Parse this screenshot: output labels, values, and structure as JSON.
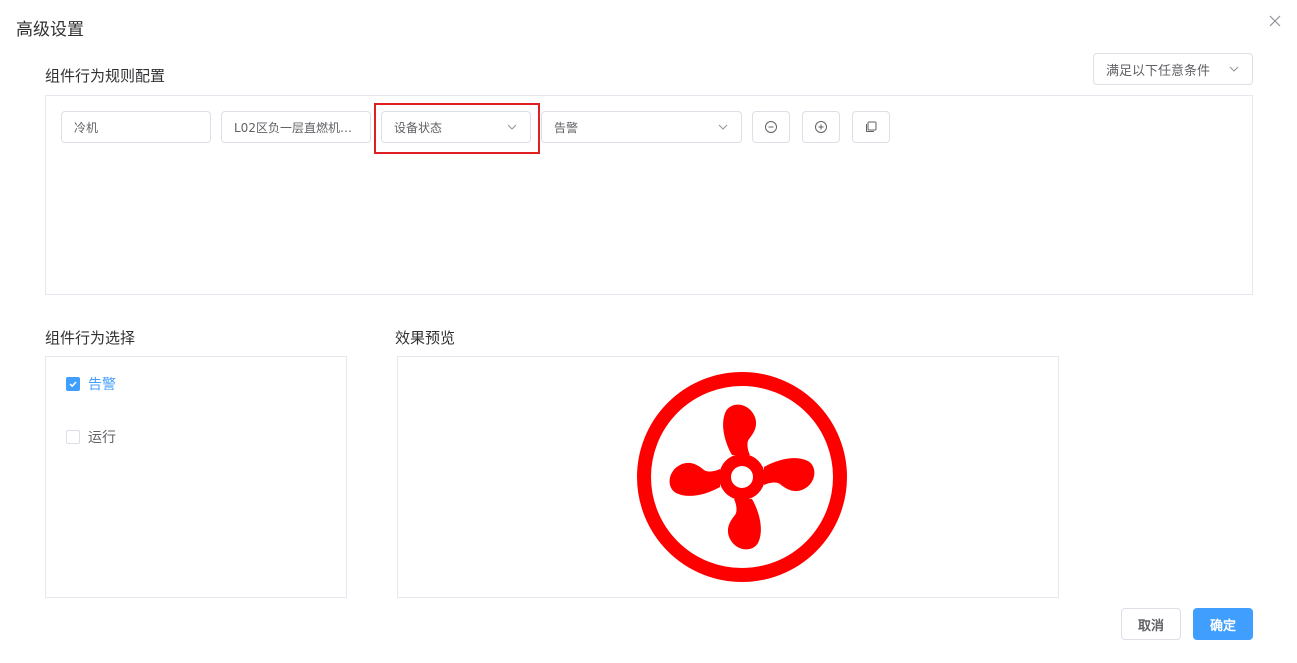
{
  "dialog": {
    "title": "高级设置"
  },
  "rule_config": {
    "title": "组件行为规则配置",
    "condition_select": "满足以下任意条件",
    "rule": {
      "device_type": "冷机",
      "device_name": "L02区负一层直燃机…",
      "attribute": "设备状态",
      "value": "告警"
    }
  },
  "behavior": {
    "title": "组件行为选择",
    "items": [
      {
        "label": "告警",
        "checked": true
      },
      {
        "label": "运行",
        "checked": false
      }
    ]
  },
  "preview": {
    "title": "效果预览",
    "icon": "fan-icon",
    "icon_color": "#ff0000"
  },
  "footer": {
    "cancel_label": "取消",
    "confirm_label": "确定"
  },
  "colors": {
    "primary": "#409eff",
    "highlight": "#e02020",
    "alarm": "#ff0000"
  }
}
